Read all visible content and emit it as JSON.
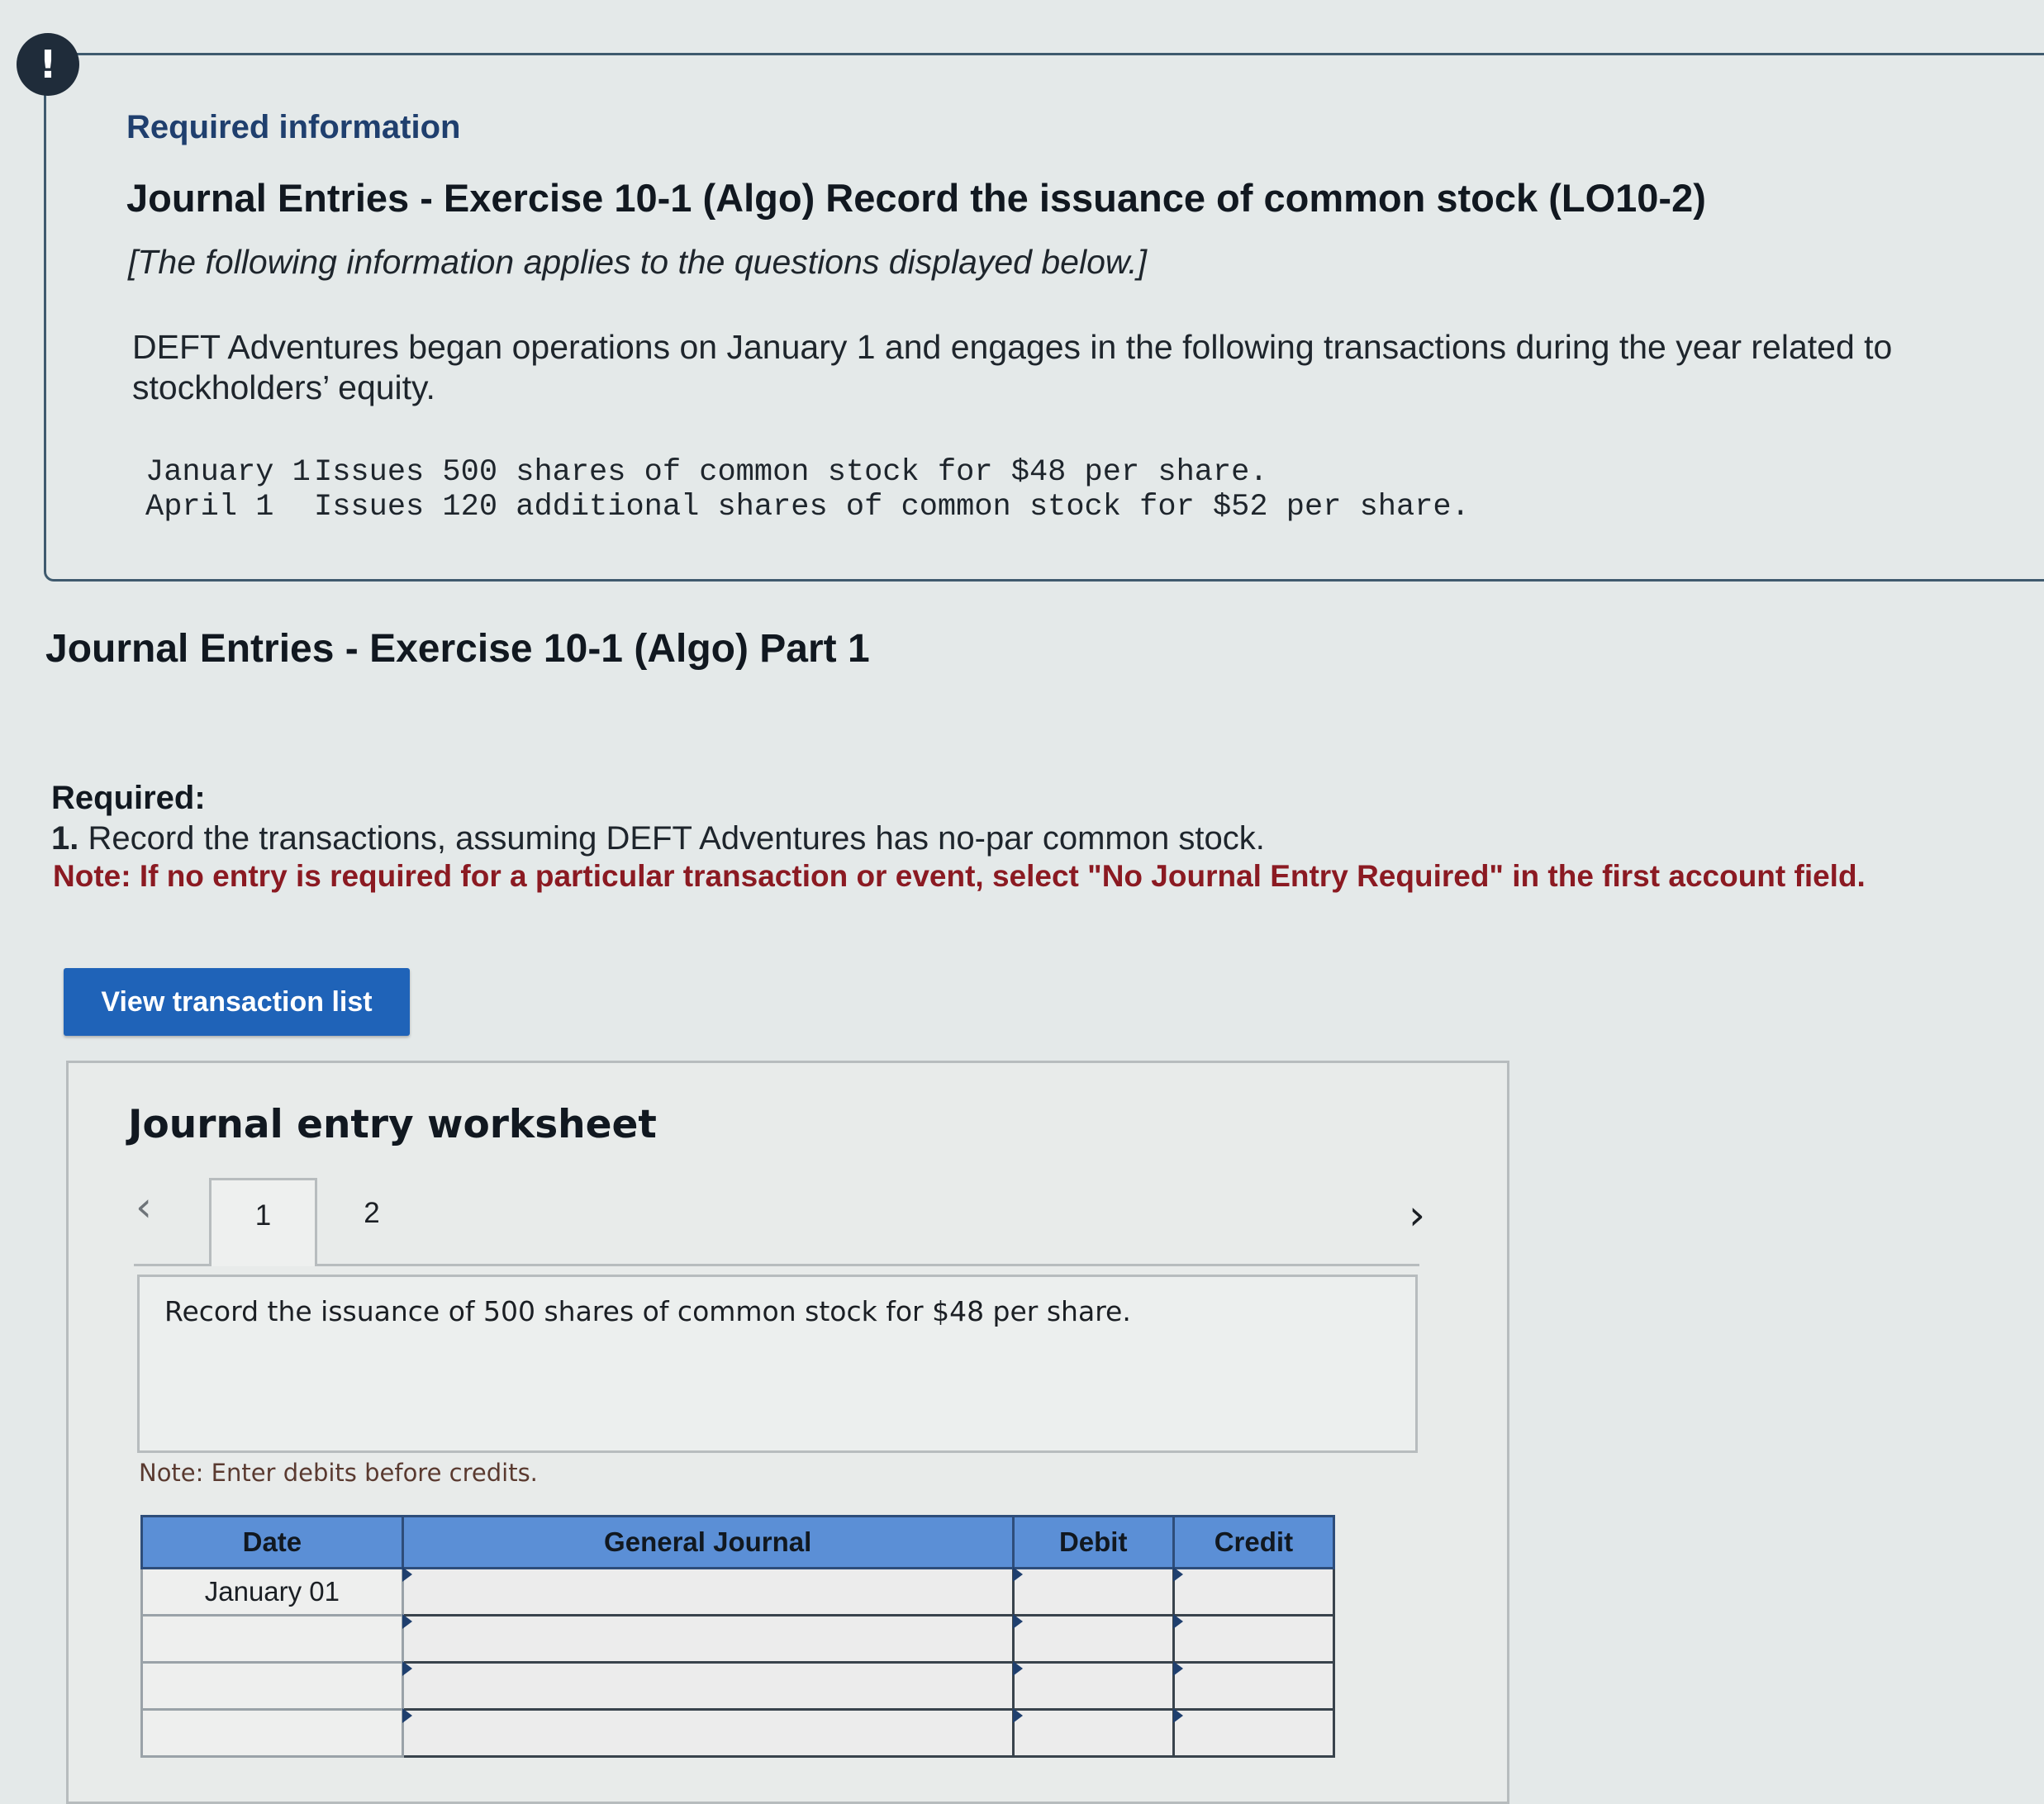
{
  "alert": {
    "badge_symbol": "!"
  },
  "required_info": {
    "heading": "Required information",
    "exercise_title": "Journal Entries - Exercise 10-1 (Algo) Record the issuance of common stock (LO10-2)",
    "applies_note": "[The following information applies to the questions displayed below.]",
    "description": "DEFT Adventures began operations on January 1 and engages in the following transactions during the year related to stockholders’ equity.",
    "transactions": [
      {
        "date": "January 1",
        "text": "Issues 500 shares of common stock for $48 per share."
      },
      {
        "date": "April 1",
        "text": "Issues 120 additional shares of common stock for $52 per share."
      }
    ]
  },
  "part": {
    "title": "Journal Entries - Exercise 10-1 (Algo) Part 1"
  },
  "required": {
    "label": "Required:",
    "item_number": "1.",
    "item_text": " Record the transactions, assuming DEFT Adventures has no-par common stock.",
    "note": "Note: If no entry is required for a particular transaction or event, select \"No Journal Entry Required\" in the first account field."
  },
  "buttons": {
    "view_transactions": "View transaction list"
  },
  "worksheet": {
    "title": "Journal entry worksheet",
    "prev_icon": "chevron-left-icon",
    "next_icon": "chevron-right-icon",
    "tabs": [
      {
        "label": "1",
        "active": true
      },
      {
        "label": "2",
        "active": false
      }
    ],
    "prompt": "Record the issuance of 500 shares of common stock for $48 per share.",
    "note": "Note: Enter debits before credits.",
    "table": {
      "headers": {
        "date": "Date",
        "general_journal": "General Journal",
        "debit": "Debit",
        "credit": "Credit"
      },
      "rows": [
        {
          "date": "January 01",
          "account": "",
          "debit": "",
          "credit": ""
        },
        {
          "date": "",
          "account": "",
          "debit": "",
          "credit": ""
        },
        {
          "date": "",
          "account": "",
          "debit": "",
          "credit": ""
        },
        {
          "date": "",
          "account": "",
          "debit": "",
          "credit": ""
        }
      ]
    }
  },
  "colors": {
    "accent_blue": "#1f63b8",
    "table_header_blue": "#5b8fd6",
    "note_red": "#8b1a22",
    "heading_navy": "#1f3f6e"
  }
}
